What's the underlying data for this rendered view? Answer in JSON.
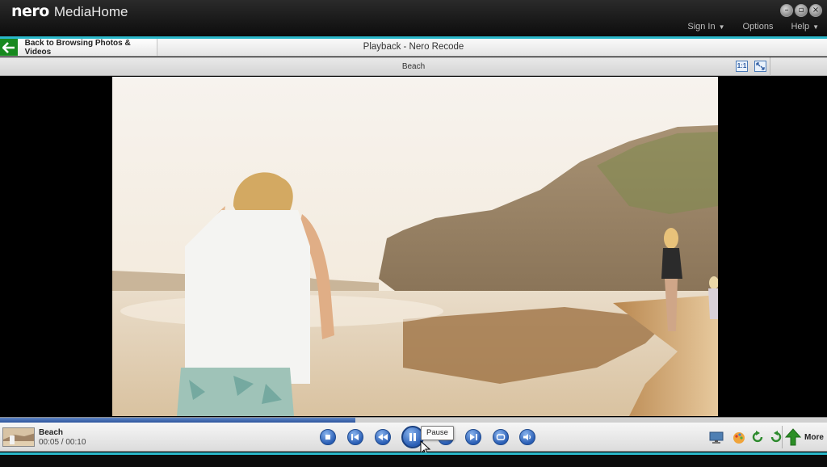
{
  "app": {
    "brand": "nero",
    "name": "MediaHome"
  },
  "window_controls": [
    "minimize-icon",
    "restore-icon",
    "close-icon"
  ],
  "top_menu": [
    {
      "label": "Sign In",
      "has_dropdown": true
    },
    {
      "label": "Options",
      "has_dropdown": false
    },
    {
      "label": "Help",
      "has_dropdown": true
    }
  ],
  "nav": {
    "back_label": "Back to Browsing Photos & Videos",
    "title": "Playback - Nero Recode"
  },
  "subbar": {
    "title": "Beach",
    "view_buttons": [
      "actual-size-icon",
      "fit-to-window-icon"
    ]
  },
  "media": {
    "title": "Beach",
    "time": "00:05 / 00:10",
    "progress_fraction": 0.43
  },
  "controls": [
    "stop-icon",
    "previous-icon",
    "rewind-icon",
    "pause-icon",
    "fast-forward-icon",
    "next-icon",
    "repeat-icon",
    "volume-icon"
  ],
  "tooltip": "Pause",
  "right_tools": [
    "display-icon",
    "paint-icon",
    "rotate-left-icon",
    "rotate-right-icon"
  ],
  "more_label": "More",
  "colors": {
    "accent": "#2ab7c9",
    "back_green": "#17891e",
    "control_blue": "#2a5eb5",
    "progress_blue": "#2d559d"
  }
}
